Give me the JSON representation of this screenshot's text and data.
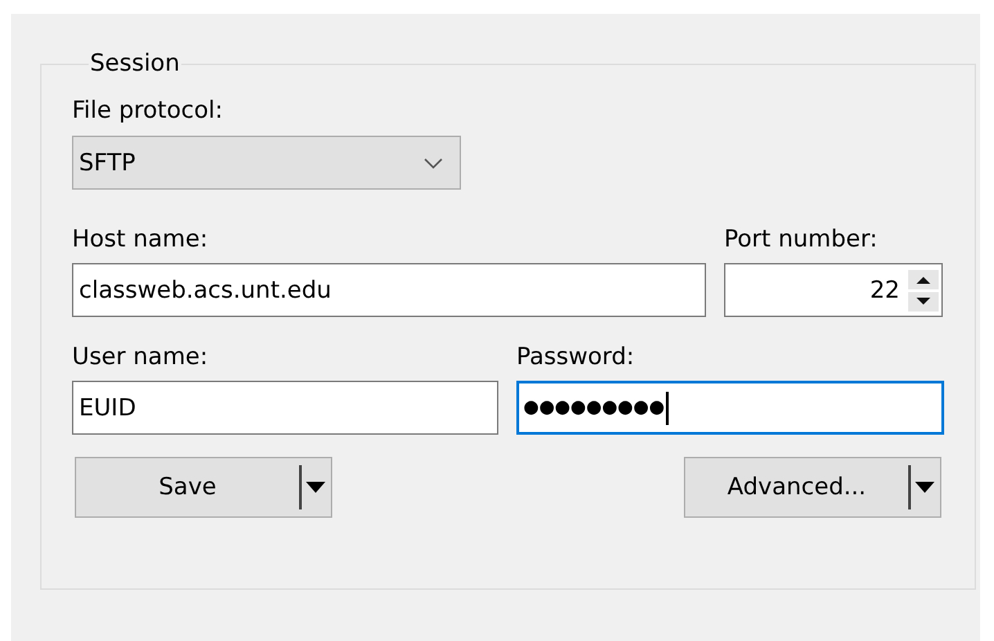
{
  "session": {
    "title": "Session",
    "file_protocol": {
      "label": "File protocol:",
      "value": "SFTP"
    },
    "host_name": {
      "label": "Host name:",
      "value": "classweb.acs.unt.edu",
      "focused": false
    },
    "port_number": {
      "label": "Port number:",
      "value": "22",
      "focused": false
    },
    "user_name": {
      "label": "User name:",
      "value": "EUID",
      "focused": false
    },
    "password": {
      "label": "Password:",
      "value": "●●●●●●●●●",
      "focused": true
    },
    "buttons": [
      {
        "label": "Save",
        "split": true
      },
      {
        "label": "Advanced...",
        "split": true
      }
    ]
  }
}
